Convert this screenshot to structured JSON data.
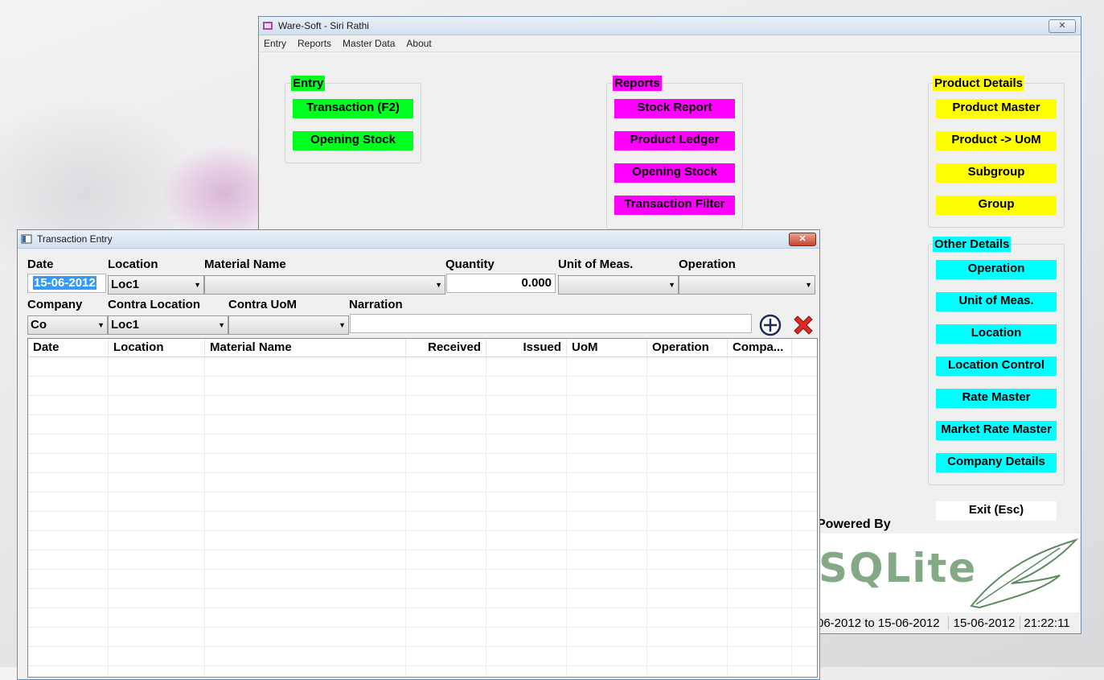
{
  "main_window": {
    "title": "Ware-Soft - Siri Rathi",
    "close_label": "✕",
    "menu": [
      "Entry",
      "Reports",
      "Master Data",
      "About"
    ],
    "entry_group": {
      "label": "Entry",
      "buttons": [
        "Transaction (F2)",
        "Opening Stock"
      ]
    },
    "reports_group": {
      "label": "Reports",
      "buttons": [
        "Stock Report",
        "Product Ledger",
        "Opening Stock",
        "Transaction Filter"
      ]
    },
    "product_group": {
      "label": "Product Details",
      "buttons": [
        "Product Master",
        "Product -> UoM",
        "Subgroup",
        "Group"
      ]
    },
    "other_group": {
      "label": "Other Details",
      "buttons": [
        "Operation",
        "Unit of Meas.",
        "Location",
        "Location Control",
        "Rate Master",
        "Market Rate Master",
        "Company Details"
      ]
    },
    "exit_button": "Exit (Esc)",
    "powered_by": "Powered By",
    "logo_text": "SQLite",
    "status": {
      "period": "06-2012 to 15-06-2012",
      "date": "15-06-2012",
      "time": "21:22:11"
    }
  },
  "transaction_window": {
    "title": "Transaction Entry",
    "labels": {
      "date": "Date",
      "location": "Location",
      "material": "Material Name",
      "quantity": "Quantity",
      "uom": "Unit of Meas.",
      "operation": "Operation",
      "company": "Company",
      "contra_location": "Contra Location",
      "contra_uom": "Contra UoM",
      "narration": "Narration"
    },
    "values": {
      "date": "15-06-2012",
      "location": "Loc1",
      "material": "",
      "quantity": "0.000",
      "uom": "",
      "operation": "",
      "company": "Co",
      "contra_location": "Loc1",
      "contra_uom": "",
      "narration": ""
    },
    "grid_columns": [
      "Date",
      "Location",
      "Material Name",
      "Received",
      "Issued",
      "UoM",
      "Operation",
      "Compa..."
    ]
  }
}
